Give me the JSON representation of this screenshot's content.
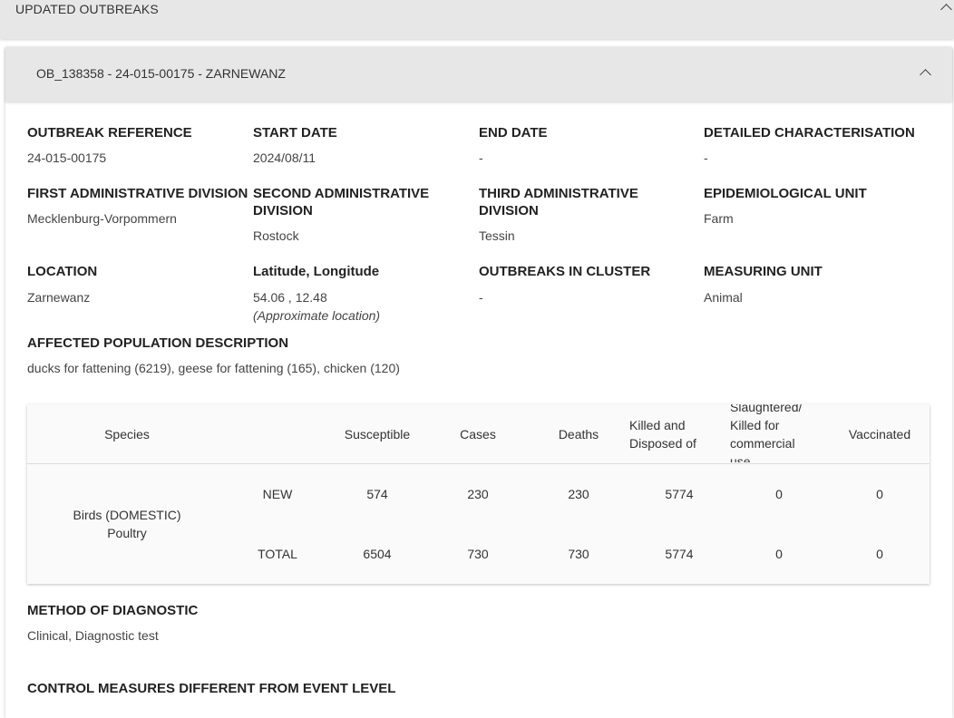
{
  "top_section": {
    "title": "UPDATED OUTBREAKS"
  },
  "outbreak": {
    "title": "OB_138358 - 24-015-00175 - ZARNEWANZ",
    "fields": {
      "outbreak_reference": {
        "label": "OUTBREAK REFERENCE",
        "value": "24-015-00175"
      },
      "start_date": {
        "label": "START DATE",
        "value": "2024/08/11"
      },
      "end_date": {
        "label": "END DATE",
        "value": "-"
      },
      "detailed_characterisation": {
        "label": "DETAILED CHARACTERISATION",
        "value": "-"
      },
      "first_admin_division": {
        "label": "FIRST ADMINISTRATIVE DIVISION",
        "value": "Mecklenburg-Vorpommern"
      },
      "second_admin_division": {
        "label_line1": "SECOND ADMINISTRATIVE",
        "label_line2": "DIVISION",
        "value": "Rostock"
      },
      "third_admin_division": {
        "label_line1": "THIRD ADMINISTRATIVE",
        "label_line2": "DIVISION",
        "value": "Tessin"
      },
      "epidemiological_unit": {
        "label": "EPIDEMIOLOGICAL UNIT",
        "value": "Farm"
      },
      "location": {
        "label": "LOCATION",
        "value": "Zarnewanz"
      },
      "lat_long": {
        "label": "Latitude, Longitude",
        "value": "54.06 , 12.48",
        "note": "(Approximate location)"
      },
      "outbreaks_in_cluster": {
        "label": "OUTBREAKS IN CLUSTER",
        "value": "-"
      },
      "measuring_unit": {
        "label": "MEASURING UNIT",
        "value": "Animal"
      },
      "affected_population": {
        "label": "AFFECTED POPULATION DESCRIPTION",
        "value": "ducks for fattening (6219), geese for fattening (165), chicken (120)"
      }
    },
    "table": {
      "headers": {
        "species": "Species",
        "susceptible": "Susceptible",
        "cases": "Cases",
        "deaths": "Deaths",
        "killed_line1": "Killed and",
        "killed_line2": "Disposed of",
        "slaughtered_line1": "Slaughtered/",
        "slaughtered_line2": "Killed for",
        "slaughtered_line3": "commercial",
        "slaughtered_line4": "use",
        "vaccinated": "Vaccinated"
      },
      "species_line1": "Birds (DOMESTIC)",
      "species_line2": "Poultry",
      "rows": [
        {
          "type": "NEW",
          "susceptible": "574",
          "cases": "230",
          "deaths": "230",
          "killed": "5774",
          "slaughtered": "0",
          "vaccinated": "0"
        },
        {
          "type": "TOTAL",
          "susceptible": "6504",
          "cases": "730",
          "deaths": "730",
          "killed": "5774",
          "slaughtered": "0",
          "vaccinated": "0"
        }
      ]
    },
    "method_of_diagnostic": {
      "label": "METHOD OF DIAGNOSTIC",
      "value": "Clinical, Diagnostic test"
    },
    "control_measures": {
      "label": "CONTROL MEASURES DIFFERENT FROM EVENT LEVEL"
    }
  }
}
